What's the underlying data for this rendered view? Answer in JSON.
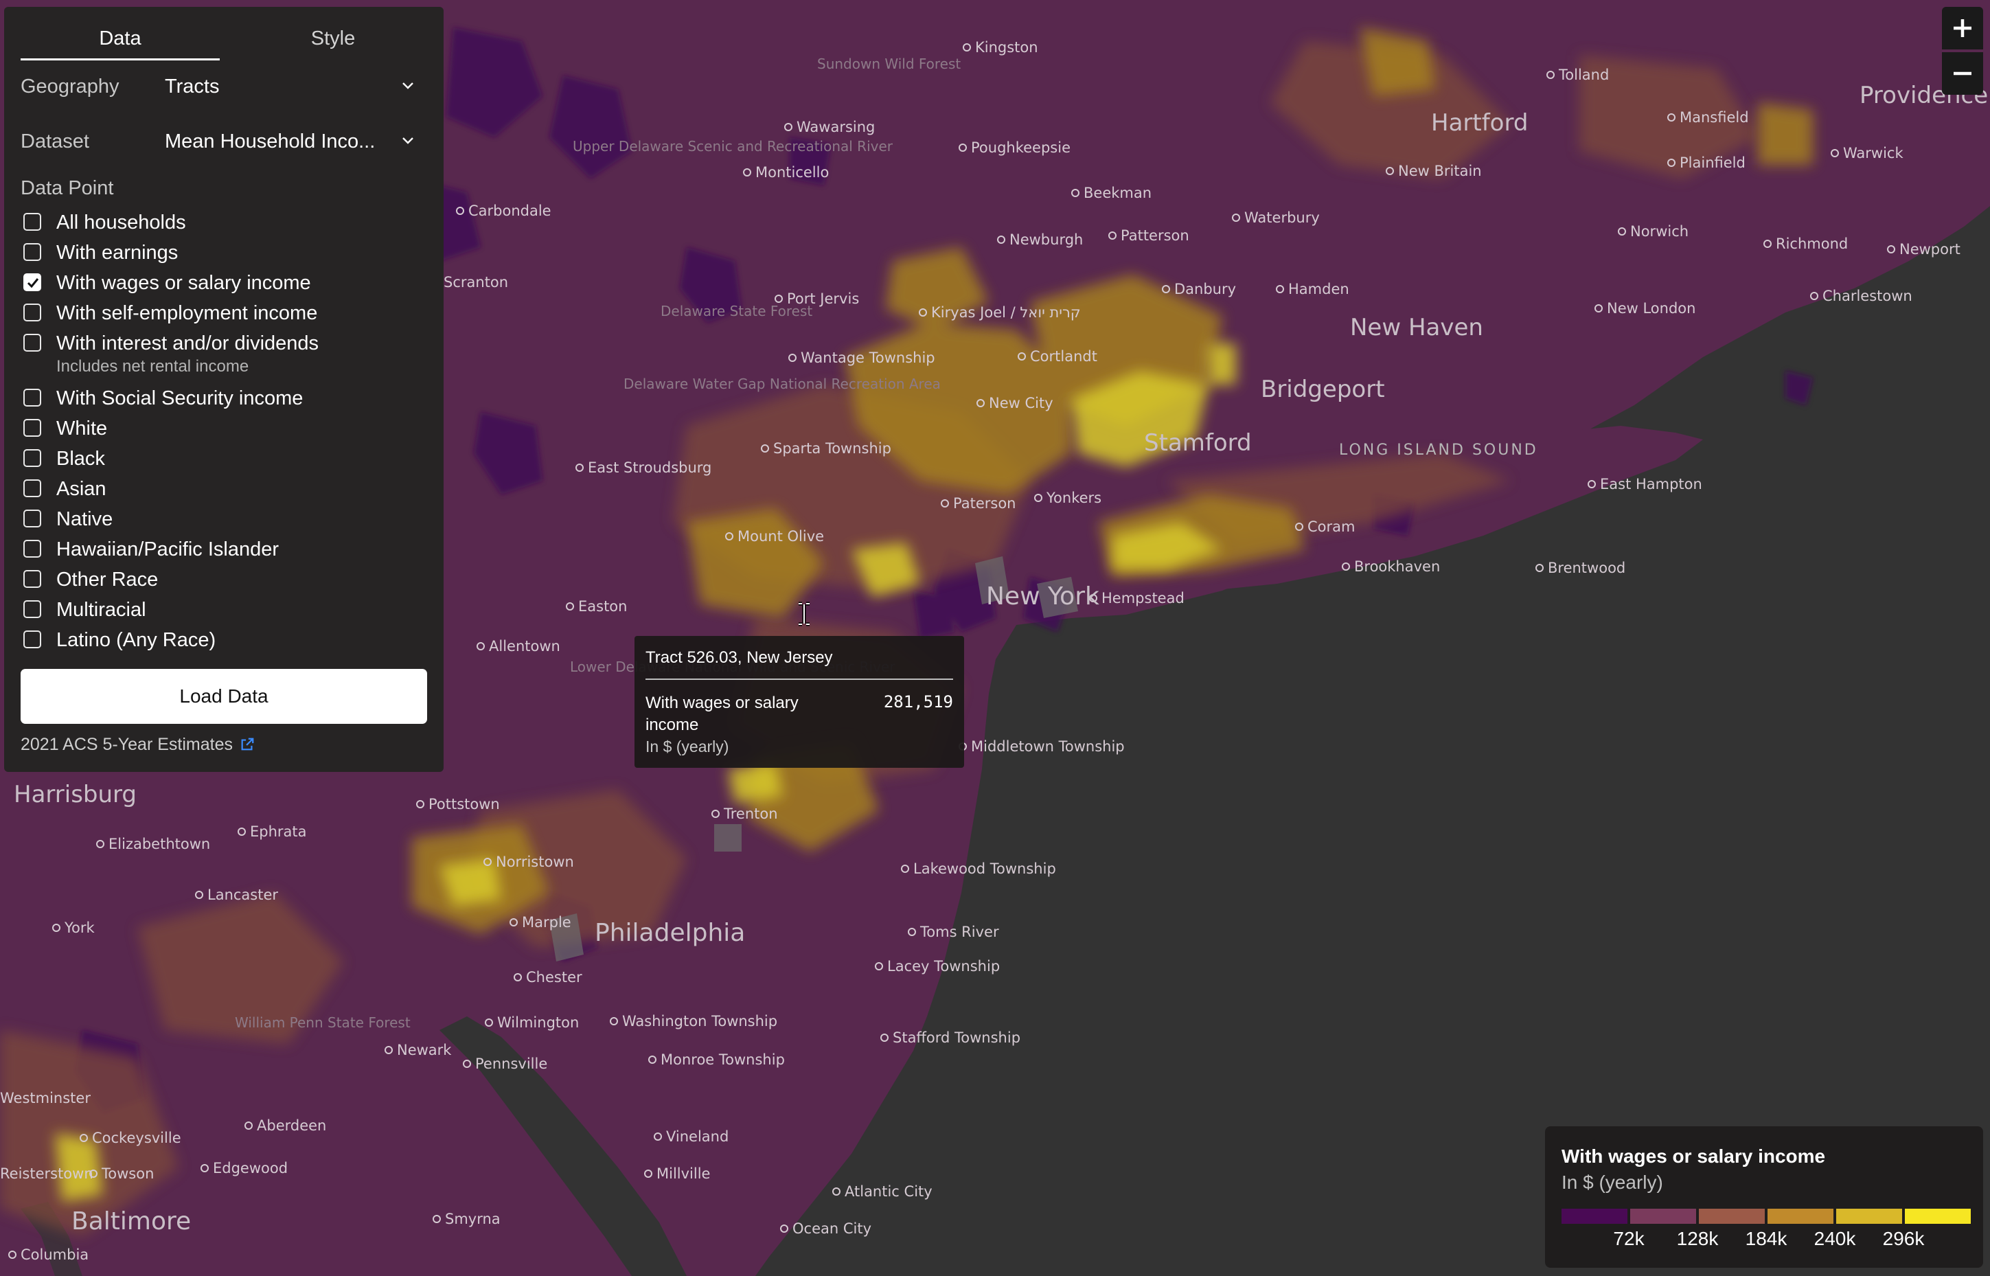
{
  "panel": {
    "tabs": [
      {
        "label": "Data",
        "active": true
      },
      {
        "label": "Style",
        "active": false
      }
    ],
    "geography": {
      "label": "Geography",
      "value": "Tracts"
    },
    "dataset": {
      "label": "Dataset",
      "value": "Mean Household Inco..."
    },
    "data_point_label": "Data Point",
    "options": [
      {
        "label": "All households",
        "checked": false
      },
      {
        "label": "With earnings",
        "checked": false
      },
      {
        "label": "With wages or salary income",
        "checked": true
      },
      {
        "label": "With self-employment income",
        "checked": false
      },
      {
        "label": "With interest and/or dividends",
        "checked": false,
        "sub": "Includes net rental income"
      },
      {
        "label": "With Social Security income",
        "checked": false
      },
      {
        "label": "White",
        "checked": false
      },
      {
        "label": "Black",
        "checked": false
      },
      {
        "label": "Asian",
        "checked": false
      },
      {
        "label": "Native",
        "checked": false
      },
      {
        "label": "Hawaiian/Pacific Islander",
        "checked": false
      },
      {
        "label": "Other Race",
        "checked": false
      },
      {
        "label": "Multiracial",
        "checked": false
      },
      {
        "label": "Latino (Any Race)",
        "checked": false
      }
    ],
    "load_button": "Load Data",
    "source": "2021 ACS 5-Year Estimates"
  },
  "zoom": {
    "in": "+",
    "out": "−"
  },
  "tooltip": {
    "title": "Tract 526.03, New Jersey",
    "label": "With wages or salary income",
    "value": "281,519",
    "unit": "In $ (yearly)"
  },
  "legend": {
    "title": "With wages or salary income",
    "unit": "In $ (yearly)",
    "colors": [
      "#4a0a55",
      "#7a3a5c",
      "#9c5a48",
      "#c08a2c",
      "#d9b82a",
      "#f6e623"
    ],
    "ticks": [
      "72k",
      "128k",
      "184k",
      "240k",
      "296k"
    ]
  },
  "map": {
    "colors": {
      "land": "#58284e",
      "water": "#333333",
      "low": "#3f1154",
      "mid": "#7d4a3a",
      "high": "#a8831e",
      "top": "#d8c92a"
    },
    "places": [
      {
        "name": "Kingston",
        "cls": "place"
      },
      {
        "name": "Sundown Wild Forest",
        "cls": "area"
      },
      {
        "name": "Tolland",
        "cls": "place"
      },
      {
        "name": "Providence",
        "cls": "lg"
      },
      {
        "name": "Hartford",
        "cls": "lg"
      },
      {
        "name": "Mansfield",
        "cls": "place"
      },
      {
        "name": "Wawarsing",
        "cls": "place"
      },
      {
        "name": "Poughkeepsie",
        "cls": "place"
      },
      {
        "name": "Upper Delaware Scenic and Recreational River",
        "cls": "area"
      },
      {
        "name": "Monticello",
        "cls": "place"
      },
      {
        "name": "New Britain",
        "cls": "place"
      },
      {
        "name": "Plainfield",
        "cls": "place"
      },
      {
        "name": "Warwick",
        "cls": "place"
      },
      {
        "name": "Beekman",
        "cls": "place"
      },
      {
        "name": "Carbondale",
        "cls": "place"
      },
      {
        "name": "Waterbury",
        "cls": "place"
      },
      {
        "name": "Newburgh",
        "cls": "place"
      },
      {
        "name": "Patterson",
        "cls": "place"
      },
      {
        "name": "Norwich",
        "cls": "place"
      },
      {
        "name": "Richmond",
        "cls": "place"
      },
      {
        "name": "Newport",
        "cls": "place"
      },
      {
        "name": "Scranton",
        "cls": "place"
      },
      {
        "name": "Danbury",
        "cls": "place"
      },
      {
        "name": "Hamden",
        "cls": "place"
      },
      {
        "name": "Port Jervis",
        "cls": "place"
      },
      {
        "name": "Delaware State Forest",
        "cls": "area"
      },
      {
        "name": "Kiryas Joel / קרית יואל",
        "cls": "place"
      },
      {
        "name": "New London",
        "cls": "place"
      },
      {
        "name": "Charlestown",
        "cls": "place"
      },
      {
        "name": "New Haven",
        "cls": "lg"
      },
      {
        "name": "Wantage Township",
        "cls": "place"
      },
      {
        "name": "Cortlandt",
        "cls": "place"
      },
      {
        "name": "Bridgeport",
        "cls": "lg"
      },
      {
        "name": "Delaware Water Gap National Recreation Area",
        "cls": "area"
      },
      {
        "name": "New City",
        "cls": "place"
      },
      {
        "name": "LONG ISLAND SOUND",
        "cls": "water"
      },
      {
        "name": "Stamford",
        "cls": "lg"
      },
      {
        "name": "Sparta Township",
        "cls": "place"
      },
      {
        "name": "East Stroudsburg",
        "cls": "place"
      },
      {
        "name": "East Hampton",
        "cls": "place"
      },
      {
        "name": "Paterson",
        "cls": "place"
      },
      {
        "name": "Yonkers",
        "cls": "place"
      },
      {
        "name": "Coram",
        "cls": "place"
      },
      {
        "name": "Mount Olive",
        "cls": "place"
      },
      {
        "name": "Brentwood",
        "cls": "place"
      },
      {
        "name": "Brookhaven",
        "cls": "place"
      },
      {
        "name": "Hempstead",
        "cls": "place"
      },
      {
        "name": "New York",
        "cls": "xl"
      },
      {
        "name": "Easton",
        "cls": "place"
      },
      {
        "name": "Allentown",
        "cls": "place"
      },
      {
        "name": "Lower Delaware National Wild and Scenic River",
        "cls": "area"
      },
      {
        "name": "Middletown Township",
        "cls": "place"
      },
      {
        "name": "Harrisburg",
        "cls": "lg"
      },
      {
        "name": "Pottstown",
        "cls": "place"
      },
      {
        "name": "Trenton",
        "cls": "place"
      },
      {
        "name": "Ephrata",
        "cls": "place"
      },
      {
        "name": "Elizabethtown",
        "cls": "place"
      },
      {
        "name": "Norristown",
        "cls": "place"
      },
      {
        "name": "Lakewood Township",
        "cls": "place"
      },
      {
        "name": "Lancaster",
        "cls": "place"
      },
      {
        "name": "York",
        "cls": "place"
      },
      {
        "name": "Marple",
        "cls": "place"
      },
      {
        "name": "Philadelphia",
        "cls": "xl"
      },
      {
        "name": "Toms River",
        "cls": "place"
      },
      {
        "name": "Lacey Township",
        "cls": "place"
      },
      {
        "name": "Chester",
        "cls": "place"
      },
      {
        "name": "William Penn State Forest",
        "cls": "area"
      },
      {
        "name": "Wilmington",
        "cls": "place"
      },
      {
        "name": "Washington Township",
        "cls": "place"
      },
      {
        "name": "Stafford Township",
        "cls": "place"
      },
      {
        "name": "Newark",
        "cls": "place"
      },
      {
        "name": "Pennsville",
        "cls": "place"
      },
      {
        "name": "Monroe Township",
        "cls": "place"
      },
      {
        "name": "Westminster",
        "cls": "place"
      },
      {
        "name": "Cockeysville",
        "cls": "place"
      },
      {
        "name": "Aberdeen",
        "cls": "place"
      },
      {
        "name": "Vineland",
        "cls": "place"
      },
      {
        "name": "Edgewood",
        "cls": "place"
      },
      {
        "name": "Towson",
        "cls": "place"
      },
      {
        "name": "Millville",
        "cls": "place"
      },
      {
        "name": "Reisterstown",
        "cls": "place"
      },
      {
        "name": "Atlantic City",
        "cls": "place"
      },
      {
        "name": "Baltimore",
        "cls": "xl"
      },
      {
        "name": "Smyrna",
        "cls": "place"
      },
      {
        "name": "Ocean City",
        "cls": "place"
      },
      {
        "name": "Columbia",
        "cls": "place"
      }
    ]
  }
}
